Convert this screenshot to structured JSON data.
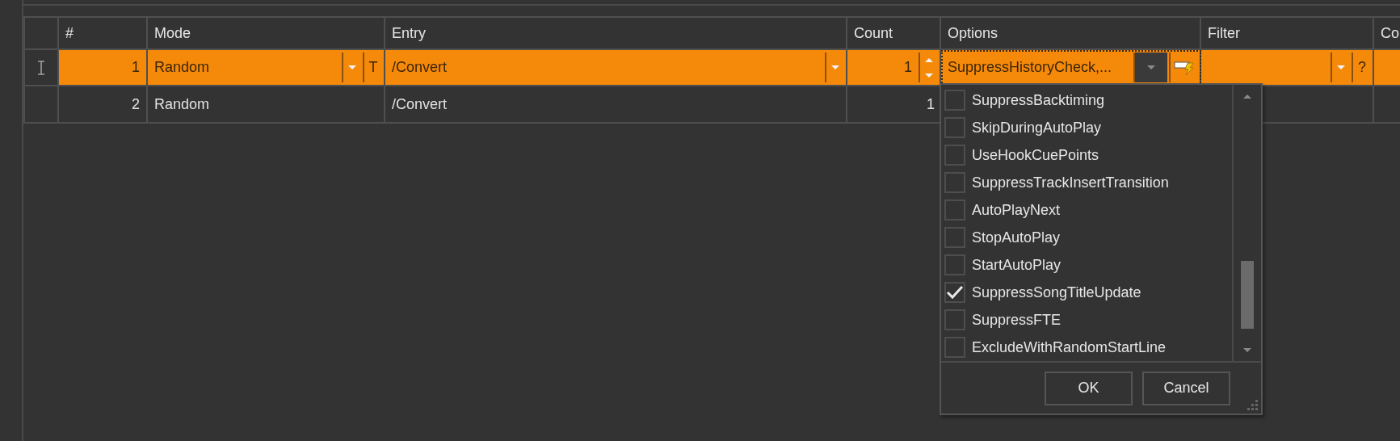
{
  "columns": [
    "#",
    "Mode",
    "Entry",
    "Count",
    "Options",
    "Filter",
    "Co"
  ],
  "rows": [
    {
      "selected": true,
      "number": "1",
      "mode": "Random",
      "mode_button": "T",
      "entry": "/Convert",
      "count": "1",
      "options": "SuppressHistoryCheck,...",
      "filter_button": "?"
    },
    {
      "selected": false,
      "number": "2",
      "mode": "Random",
      "entry": "/Convert",
      "count": "1"
    }
  ],
  "options_popup": {
    "items": [
      {
        "label": "SuppressBacktiming",
        "checked": false
      },
      {
        "label": "SkipDuringAutoPlay",
        "checked": false
      },
      {
        "label": "UseHookCuePoints",
        "checked": false
      },
      {
        "label": "SuppressTrackInsertTransition",
        "checked": false
      },
      {
        "label": "AutoPlayNext",
        "checked": false
      },
      {
        "label": "StopAutoPlay",
        "checked": false
      },
      {
        "label": "StartAutoPlay",
        "checked": false
      },
      {
        "label": "SuppressSongTitleUpdate",
        "checked": true
      },
      {
        "label": "SuppressFTE",
        "checked": false
      },
      {
        "label": "ExcludeWithRandomStartLine",
        "checked": false
      }
    ],
    "buttons": [
      "OK",
      "Cancel"
    ]
  }
}
